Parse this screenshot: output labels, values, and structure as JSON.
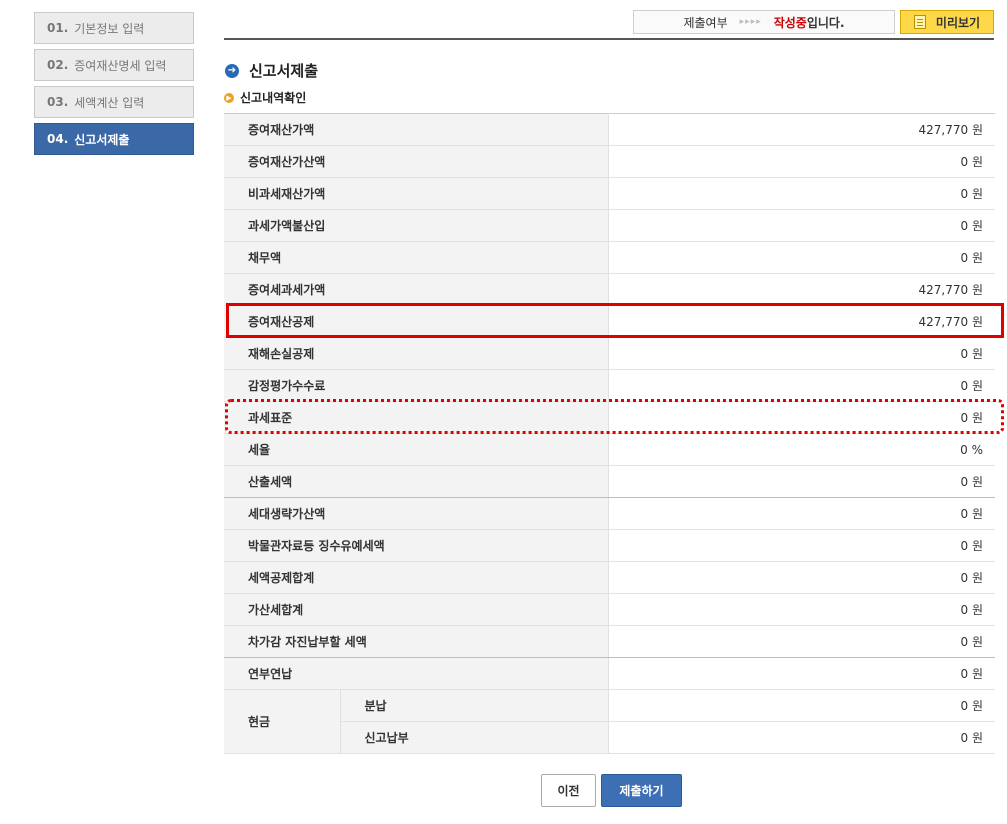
{
  "sidebar": {
    "steps": [
      {
        "num": "01.",
        "label": "기본정보 입력"
      },
      {
        "num": "02.",
        "label": "증여재산명세 입력"
      },
      {
        "num": "03.",
        "label": "세액계산 입력"
      },
      {
        "num": "04.",
        "label": "신고서제출"
      }
    ]
  },
  "header": {
    "status_label": "제출여부",
    "status_arrows": "▸▸▸▸",
    "status_state": "작성중",
    "status_suffix": "입니다.",
    "preview_label": "미리보기"
  },
  "page": {
    "title": "신고서제출",
    "subtitle": "신고내역확인"
  },
  "rows": [
    {
      "label": "증여재산가액",
      "value": "427,770 원"
    },
    {
      "label": "증여재산가산액",
      "value": "0 원"
    },
    {
      "label": "비과세재산가액",
      "value": "0 원"
    },
    {
      "label": "과세가액불산입",
      "value": "0 원"
    },
    {
      "label": "채무액",
      "value": "0 원"
    },
    {
      "label": "증여세과세가액",
      "value": "427,770 원"
    },
    {
      "label": "증여재산공제",
      "value": "427,770 원"
    },
    {
      "label": "재해손실공제",
      "value": "0 원"
    },
    {
      "label": "감정평가수수료",
      "value": "0 원"
    },
    {
      "label": "과세표준",
      "value": "0 원"
    },
    {
      "label": "세율",
      "value": "0 %"
    },
    {
      "label": "산출세액",
      "value": "0 원"
    },
    {
      "label": "세대생략가산액",
      "value": "0 원"
    },
    {
      "label": "박물관자료등 징수유예세액",
      "value": "0 원"
    },
    {
      "label": "세액공제합계",
      "value": "0 원"
    },
    {
      "label": "가산세합계",
      "value": "0 원"
    },
    {
      "label": "차가감 자진납부할 세액",
      "value": "0 원"
    },
    {
      "label": "연부연납",
      "value": "0 원"
    }
  ],
  "cash": {
    "group_label": "현금",
    "items": [
      {
        "label": "분납",
        "value": "0 원"
      },
      {
        "label": "신고납부",
        "value": "0 원"
      }
    ]
  },
  "buttons": {
    "prev": "이전",
    "submit": "제출하기"
  },
  "colors": {
    "accent": "#3b69a8",
    "highlight": "#e00000",
    "preview_bg": "#ffd84a"
  }
}
